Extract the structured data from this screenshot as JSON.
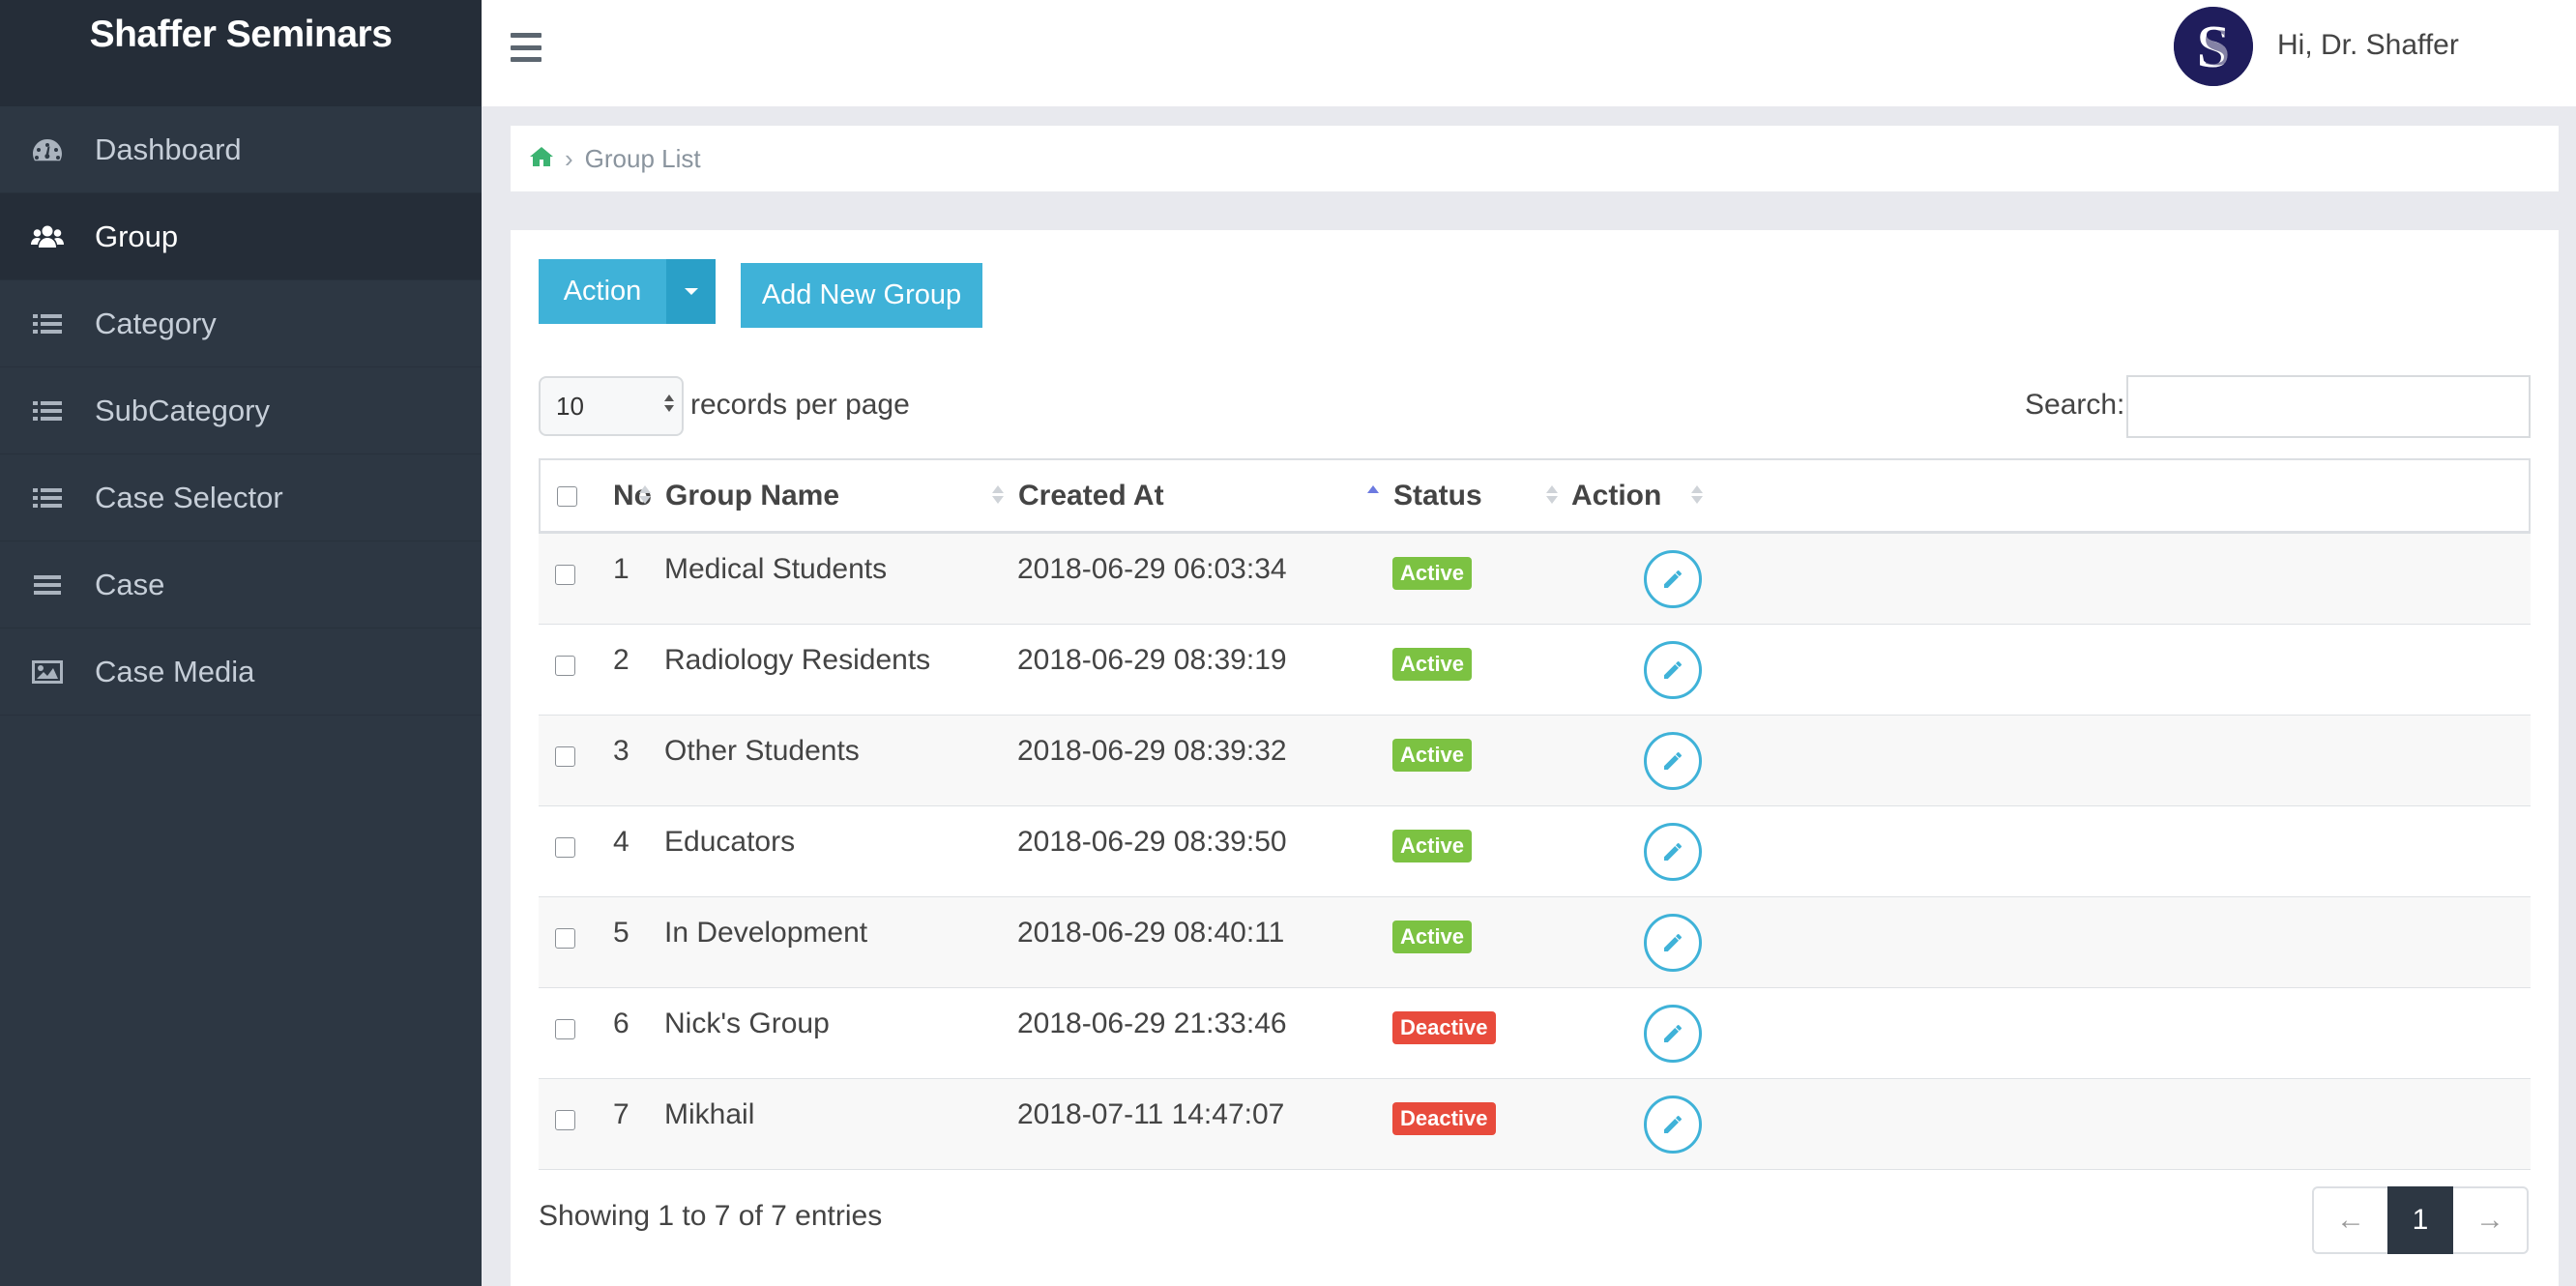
{
  "sidebar": {
    "brand": "Shaffer Seminars",
    "items": [
      {
        "label": "Dashboard",
        "icon": "dashboard-icon"
      },
      {
        "label": "Group",
        "icon": "users-icon"
      },
      {
        "label": "Category",
        "icon": "list-icon"
      },
      {
        "label": "SubCategory",
        "icon": "list-icon"
      },
      {
        "label": "Case Selector",
        "icon": "list-icon"
      },
      {
        "label": "Case",
        "icon": "bars-icon"
      },
      {
        "label": "Case Media",
        "icon": "image-icon"
      }
    ],
    "active_index": 1
  },
  "topbar": {
    "greeting": "Hi, Dr. Shaffer",
    "avatar_letter": "S"
  },
  "breadcrumb": {
    "current": "Group List",
    "separator": "›"
  },
  "toolbar": {
    "action_label": "Action",
    "add_label": "Add New Group"
  },
  "table_controls": {
    "page_length": "10",
    "length_suffix": "records per page",
    "search_label": "Search:",
    "search_value": ""
  },
  "table": {
    "headers": {
      "no": "No",
      "group_name": "Group Name",
      "created_at": "Created At",
      "status": "Status",
      "action": "Action"
    },
    "sorted_column": "created_at",
    "rows": [
      {
        "no": "1",
        "group_name": "Medical Students",
        "created_at": "2018-06-29 06:03:34",
        "status": "Active"
      },
      {
        "no": "2",
        "group_name": "Radiology Residents",
        "created_at": "2018-06-29 08:39:19",
        "status": "Active"
      },
      {
        "no": "3",
        "group_name": "Other Students",
        "created_at": "2018-06-29 08:39:32",
        "status": "Active"
      },
      {
        "no": "4",
        "group_name": "Educators",
        "created_at": "2018-06-29 08:39:50",
        "status": "Active"
      },
      {
        "no": "5",
        "group_name": "In Development",
        "created_at": "2018-06-29 08:40:11",
        "status": "Active"
      },
      {
        "no": "6",
        "group_name": "Nick's Group",
        "created_at": "2018-06-29 21:33:46",
        "status": "Deactive"
      },
      {
        "no": "7",
        "group_name": "Mikhail",
        "created_at": "2018-07-11 14:47:07",
        "status": "Deactive"
      }
    ]
  },
  "footer": {
    "info": "Showing 1 to 7 of 7 entries",
    "prev": "←",
    "current_page": "1",
    "next": "→"
  },
  "colors": {
    "sidebar": "#2d3743",
    "accent": "#3fb2d8",
    "active_badge": "#7cc242",
    "deactive_badge": "#e84b3c"
  }
}
